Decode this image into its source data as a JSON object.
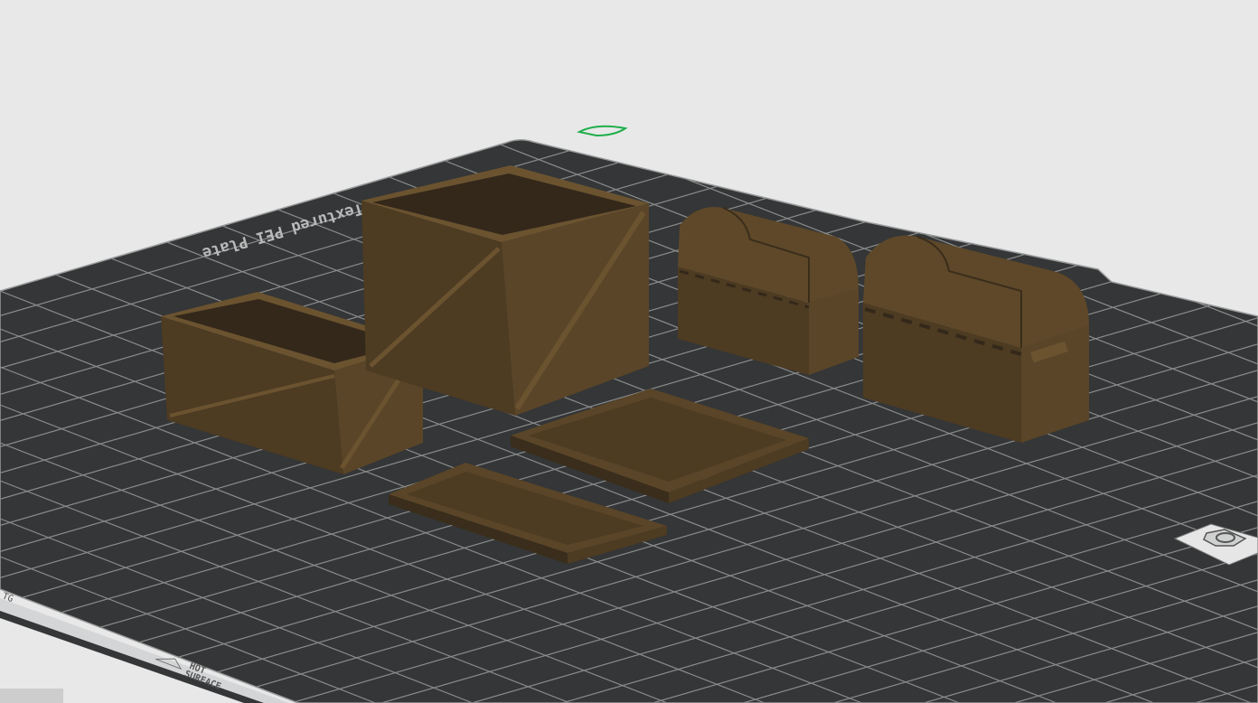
{
  "viewport": {
    "name": "3D build plate view"
  },
  "plate": {
    "label": "Textured PEI Plate",
    "warning": "HOT SURFACE",
    "warning_line1": "HOT",
    "warning_line2": "SURFACE",
    "edge_fragment": "TG"
  },
  "objects": [
    {
      "name": "large-crate"
    },
    {
      "name": "small-crate"
    },
    {
      "name": "large-crate-lid"
    },
    {
      "name": "small-crate-lid"
    },
    {
      "name": "small-chest"
    },
    {
      "name": "large-chest"
    }
  ],
  "colors": {
    "background": "#e8e8e8",
    "plate": "#343637",
    "grid": "#8a8c8c",
    "plate_strip": "#d3d5d6",
    "wood_front": "#4d3b22",
    "wood_side": "#5a4528",
    "wood_dark": "#33281a",
    "wood_light": "#6b5330",
    "marker": "#1fae4b"
  }
}
